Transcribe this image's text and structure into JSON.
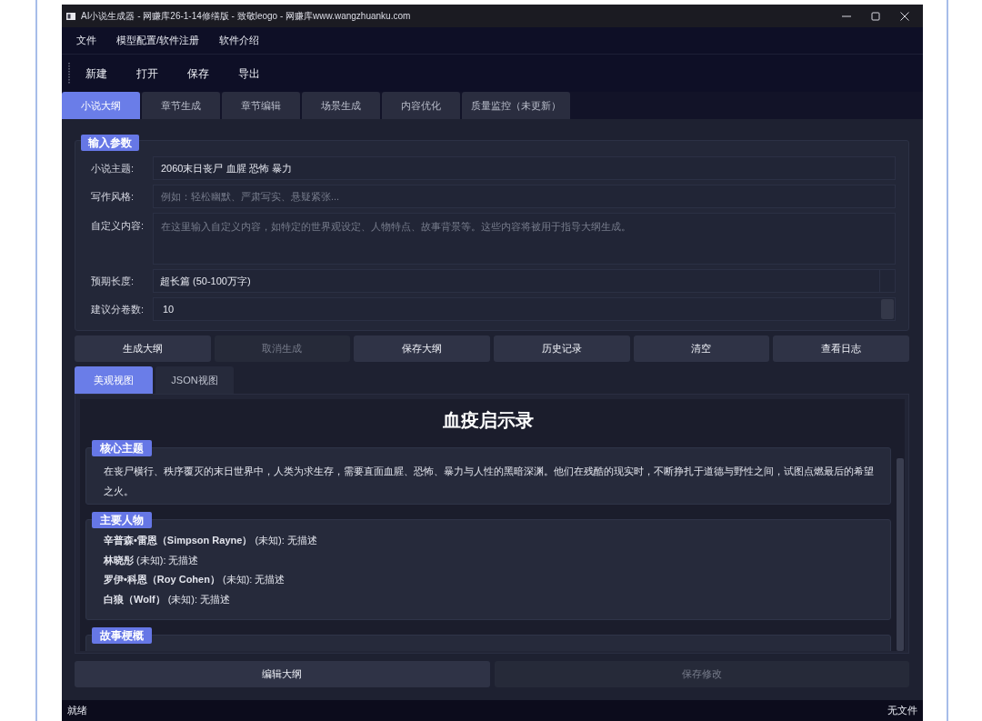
{
  "window": {
    "title": "AI小说生成器 - 网赚库26-1-14修缮版 - 致敬leogo - 网赚库www.wangzhuanku.com"
  },
  "menu": [
    "文件",
    "模型配置/软件注册",
    "软件介绍"
  ],
  "toolbar": [
    "新建",
    "打开",
    "保存",
    "导出"
  ],
  "tabs": [
    {
      "label": "小说大纲",
      "selected": true
    },
    {
      "label": "章节生成",
      "selected": false
    },
    {
      "label": "章节编辑",
      "selected": false
    },
    {
      "label": "场景生成",
      "selected": false
    },
    {
      "label": "内容优化",
      "selected": false
    },
    {
      "label": "质量监控（未更新）",
      "selected": false
    }
  ],
  "input_group": {
    "title": "输入参数",
    "fields": [
      {
        "kind": "text",
        "label": "小说主题:",
        "value": "2060末日丧尸 血腥 恐怖 暴力"
      },
      {
        "kind": "text",
        "label": "写作风格:",
        "placeholder": "例如：轻松幽默、严肃写实、悬疑紧张..."
      },
      {
        "kind": "textarea",
        "label": "自定义内容:",
        "placeholder": "在这里输入自定义内容，如特定的世界观设定、人物特点、故事背景等。这些内容将被用于指导大纲生成。"
      },
      {
        "kind": "select",
        "label": "预期长度:",
        "value": "超长篇 (50-100万字)"
      },
      {
        "kind": "spin",
        "label": "建议分卷数:",
        "value": "10"
      }
    ]
  },
  "actions": [
    {
      "label": "生成大纲",
      "disabled": false
    },
    {
      "label": "取消生成",
      "disabled": true
    },
    {
      "label": "保存大纲",
      "disabled": false
    },
    {
      "label": "历史记录",
      "disabled": false
    },
    {
      "label": "清空",
      "disabled": false
    },
    {
      "label": "查看日志",
      "disabled": false
    }
  ],
  "view_tabs": [
    {
      "label": "美观视图",
      "selected": true
    },
    {
      "label": "JSON视图",
      "selected": false
    }
  ],
  "outline": {
    "title": "血疫启示录",
    "sections": [
      {
        "kind": "paragraph",
        "heading": "核心主题",
        "text": "在丧尸横行、秩序覆灭的末日世界中，人类为求生存，需要直面血腥、恐怖、暴力与人性的黑暗深渊。他们在残酷的现实时，不断挣扎于道德与野性之间，试图点燃最后的希望之火。"
      },
      {
        "kind": "list",
        "heading": "主要人物",
        "items": [
          "**辛普森•雷恩（Simpson Rayne）** (未知): 无描述",
          "**林晓彤** (未知): 无描述",
          "**罗伊•科恩（Roy Cohen）** (未知): 无描述",
          "**白狼（Wolf）** (未知): 无描述"
        ]
      },
      {
        "kind": "paragraph",
        "heading": "故事梗概"
      }
    ]
  },
  "edit_buttons": [
    {
      "label": "编辑大纲",
      "disabled": false
    },
    {
      "label": "保存修改",
      "disabled": true
    }
  ],
  "status_bar": {
    "message": "就绪",
    "file": "无文件"
  }
}
